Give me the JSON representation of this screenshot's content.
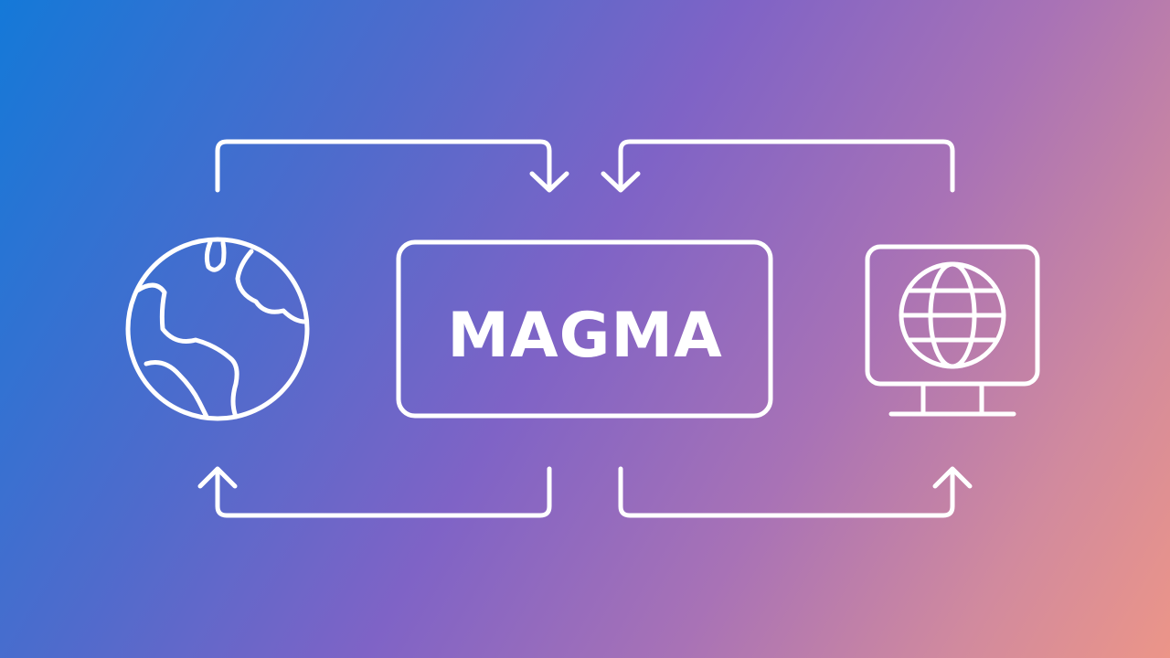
{
  "central_box": {
    "title": "MAGMA"
  },
  "icons": {
    "left": "earth-globe-icon",
    "right": "monitor-with-globe-icon"
  },
  "colors": {
    "gradient_start": "#1479d8",
    "gradient_mid": "#7f63c6",
    "gradient_end": "#ec9588",
    "stroke": "#ffffff"
  }
}
